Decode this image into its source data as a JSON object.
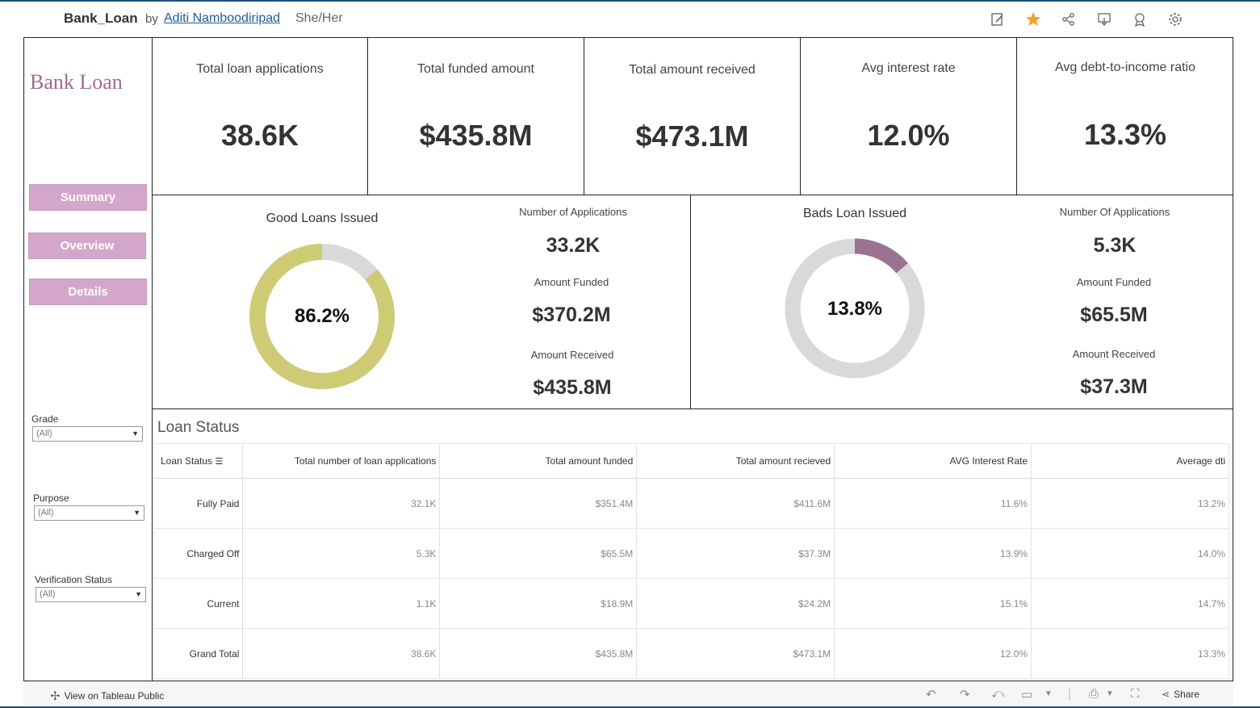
{
  "header": {
    "title": "Bank_Loan",
    "by": "by",
    "author": "Aditi Namboodiripad",
    "pronouns": "She/Her",
    "icons": [
      "edit-icon",
      "favorite-star-icon",
      "share-network-icon",
      "download-icon",
      "badge-icon",
      "settings-gear-icon"
    ]
  },
  "sidebar": {
    "brand": "Bank Loan",
    "nav": [
      {
        "label": "Summary"
      },
      {
        "label": "Overview"
      },
      {
        "label": "Details"
      }
    ],
    "filters": [
      {
        "label": "Grade",
        "value": "(All)"
      },
      {
        "label": "Purpose",
        "value": "(All)"
      },
      {
        "label": "Verification Status",
        "value": "(All)"
      }
    ]
  },
  "kpis": [
    {
      "label": "Total loan applications",
      "value": "38.6K"
    },
    {
      "label": "Total funded amount",
      "value": "$435.8M"
    },
    {
      "label": "Total amount received",
      "value": "$473.1M"
    },
    {
      "label": "Avg interest rate",
      "value": "12.0%"
    },
    {
      "label": "Avg debt-to-income ratio",
      "value": "13.3%"
    }
  ],
  "good": {
    "title": "Good Loans Issued",
    "pct_label": "86.2%",
    "pct": 0.862,
    "color": "#cfcb75",
    "rest_color": "#d9d9d9",
    "apps_label": "Number of Applications",
    "apps": "33.2K",
    "funded_label": "Amount Funded",
    "funded": "$370.2M",
    "received_label": "Amount Received",
    "received": "$435.8M"
  },
  "bad": {
    "title": "Bads Loan Issued",
    "pct_label": "13.8%",
    "pct": 0.138,
    "color": "#9a7393",
    "rest_color": "#d9d9d9",
    "apps_label": "Number Of Applications",
    "apps": "5.3K",
    "funded_label": "Amount Funded",
    "funded": "$65.5M",
    "received_label": "Amount Received",
    "received": "$37.3M"
  },
  "loan_status": {
    "title": "Loan Status",
    "columns": [
      "Loan Status",
      "Total number of loan applications",
      "Total amount funded",
      "Total amount recieved",
      "AVG Interest Rate",
      "Average dti"
    ],
    "rows": [
      [
        "Fully Paid",
        "32.1K",
        "$351.4M",
        "$411.6M",
        "11.6%",
        "13.2%"
      ],
      [
        "Charged Off",
        "5.3K",
        "$65.5M",
        "$37.3M",
        "13.9%",
        "14.0%"
      ],
      [
        "Current",
        "1.1K",
        "$18.9M",
        "$24.2M",
        "15.1%",
        "14.7%"
      ],
      [
        "Grand Total",
        "38.6K",
        "$435.8M",
        "$473.1M",
        "12.0%",
        "13.3%"
      ]
    ]
  },
  "footer": {
    "view_label": "View on Tableau Public",
    "share_label": "Share"
  }
}
